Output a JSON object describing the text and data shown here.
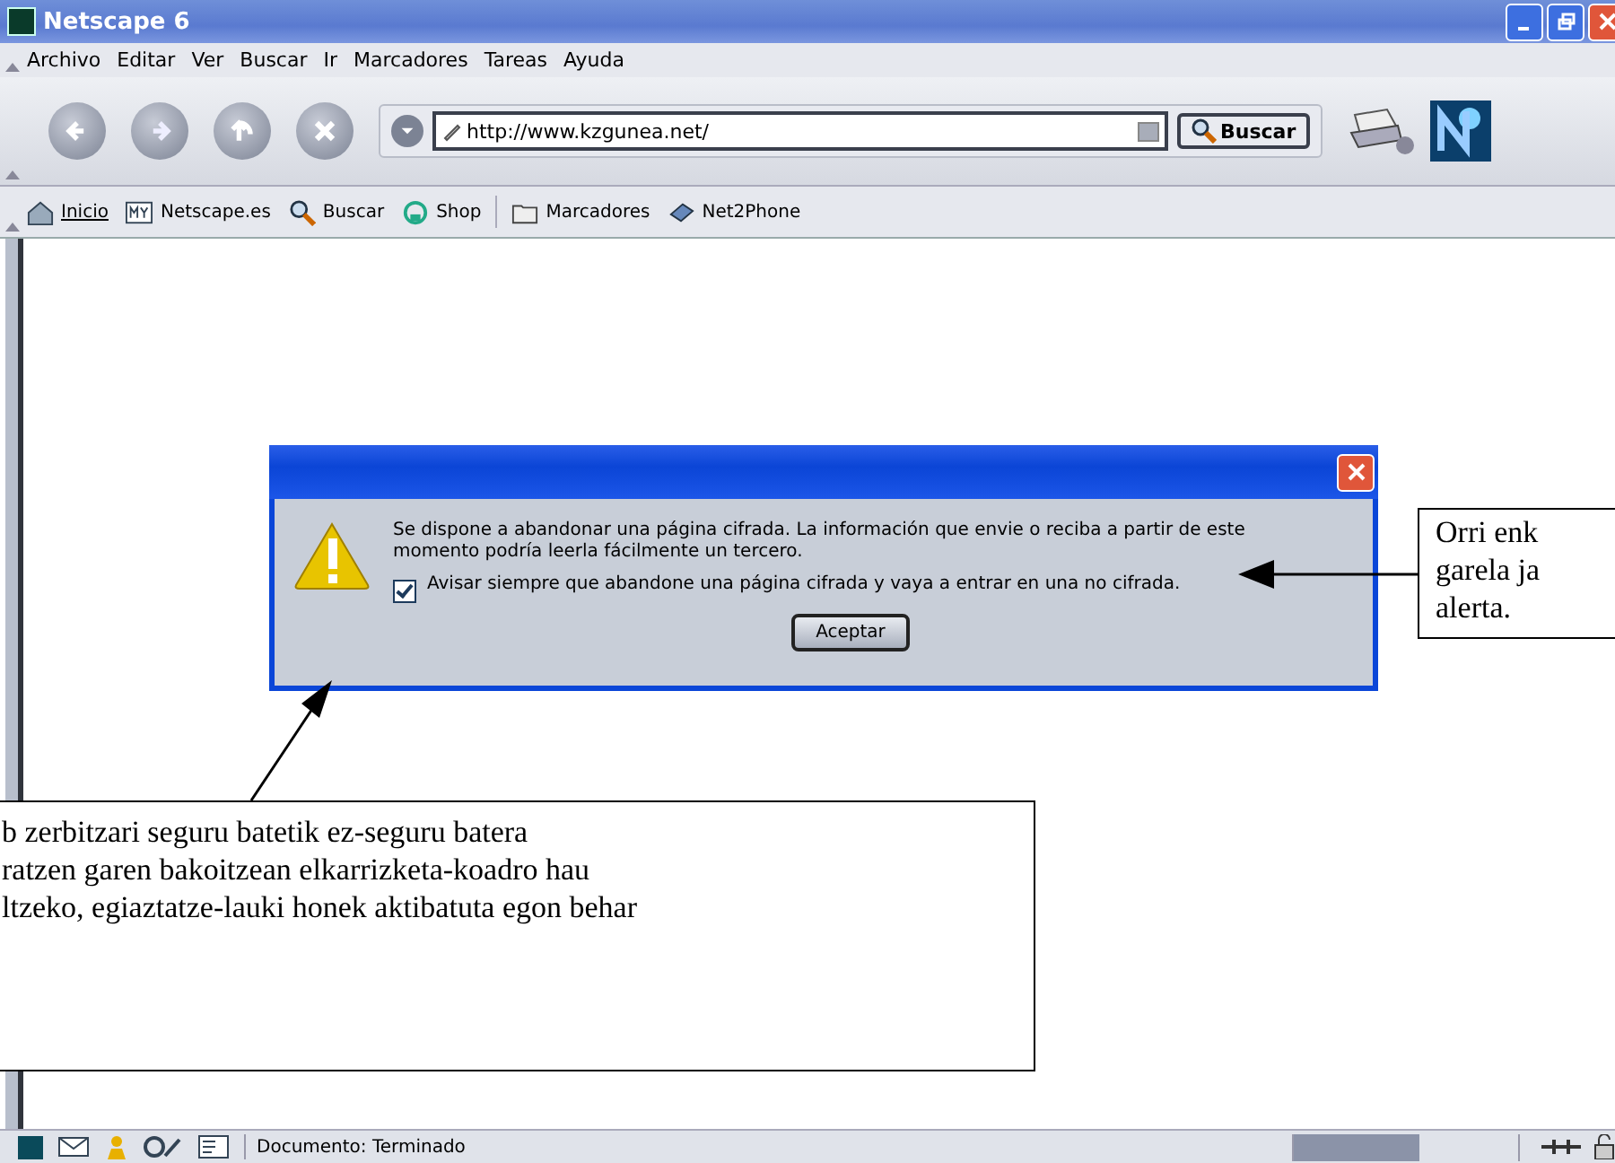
{
  "window": {
    "title": "Netscape 6"
  },
  "menu": [
    {
      "label": "Archivo"
    },
    {
      "label": "Editar"
    },
    {
      "label": "Ver"
    },
    {
      "label": "Buscar"
    },
    {
      "label": "Ir"
    },
    {
      "label": "Marcadores"
    },
    {
      "label": "Tareas"
    },
    {
      "label": "Ayuda"
    }
  ],
  "navigation": {
    "url": "http://www.kzgunea.net/",
    "search_button": "Buscar"
  },
  "personal_toolbar": [
    {
      "label": "Inicio",
      "kind": "home",
      "underlined": true
    },
    {
      "label": "Netscape.es",
      "kind": "my",
      "underlined": false
    },
    {
      "label": "Buscar",
      "kind": "search",
      "underlined": false
    },
    {
      "label": "Shop",
      "kind": "shop",
      "underlined": false
    },
    {
      "label": "Marcadores",
      "kind": "folder",
      "underlined": false
    },
    {
      "label": "Net2Phone",
      "kind": "phone",
      "underlined": false
    }
  ],
  "dialog": {
    "message": "Se dispone a abandonar una página cifrada. La información que envie o reciba a partir de este momento podría leerla fácilmente un tercero.",
    "checkbox": {
      "label": "Avisar siempre que abandone una página cifrada y vaya a entrar en una no cifrada.",
      "checked": true
    },
    "button": "Aceptar"
  },
  "callouts": [
    {
      "kind": "right",
      "lines": [
        "Orri enk",
        "garela ja",
        "alerta."
      ]
    },
    {
      "kind": "bottom",
      "lines": [
        "b zerbitzari seguru batetik ez-seguru batera",
        "ratzen garen bakoitzean elkarrizketa-koadro hau",
        "ltzeko, egiaztatze-lauki honek aktibatuta egon behar"
      ]
    }
  ],
  "status_bar": {
    "text": "Documento: Terminado",
    "progress": {
      "level": 0.56
    }
  }
}
